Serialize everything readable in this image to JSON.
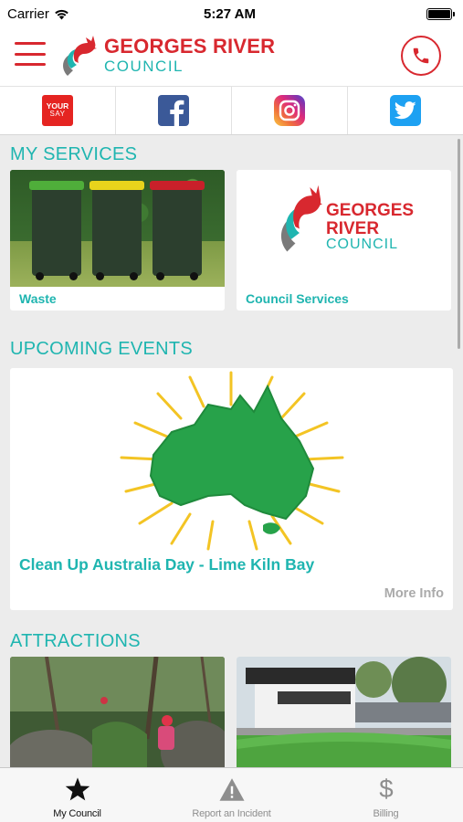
{
  "status_bar": {
    "carrier": "Carrier",
    "time": "5:27 AM"
  },
  "header": {
    "logo_line1": "GEORGES RIVER",
    "logo_line2": "COUNCIL"
  },
  "social": {
    "yoursay_line1": "YOUR",
    "yoursay_line2": "SAY",
    "items": [
      "yoursay-icon",
      "facebook-icon",
      "instagram-icon",
      "twitter-icon"
    ]
  },
  "my_services": {
    "title": "MY SERVICES",
    "cards": [
      {
        "label": "Waste"
      },
      {
        "label": "Council Services",
        "logo_line1": "GEORGES",
        "logo_line2": "RIVER",
        "logo_line3": "COUNCIL"
      }
    ]
  },
  "upcoming_events": {
    "title": "UPCOMING EVENTS",
    "event_title": "Clean Up Australia Day - Lime Kiln Bay",
    "more_info": "More Info"
  },
  "attractions": {
    "title": "ATTRACTIONS"
  },
  "tabs": [
    {
      "label": "My Council",
      "icon": "star-icon",
      "active": true
    },
    {
      "label": "Report an Incident",
      "icon": "warning-icon",
      "active": false
    },
    {
      "label": "Billing",
      "icon": "dollar-icon",
      "active": false
    }
  ],
  "colors": {
    "brand_red": "#d8282f",
    "brand_teal": "#1fb5b0",
    "event_green": "#27a24a",
    "sun_yellow": "#f3c424"
  }
}
